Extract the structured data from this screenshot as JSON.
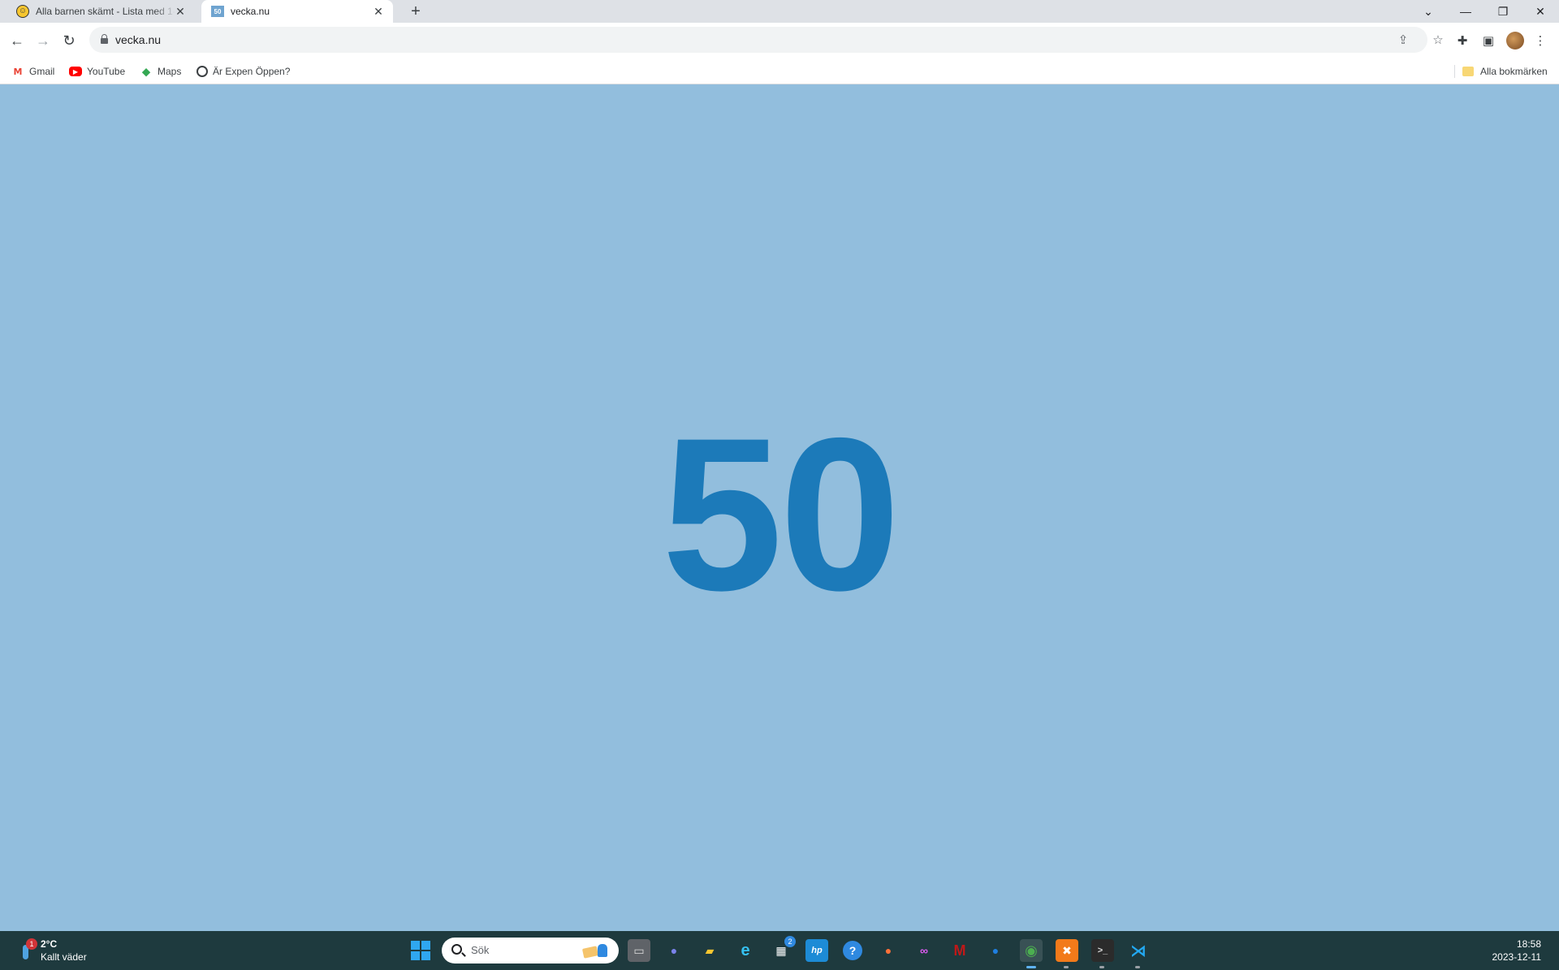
{
  "browser": {
    "tabs": [
      {
        "title": "Alla barnen skämt - Lista med 1-",
        "favicon": "laughing-emoji-icon",
        "active": false
      },
      {
        "title": "vecka.nu",
        "favicon": "50",
        "active": true
      }
    ],
    "new_tab": "+",
    "window_controls": {
      "tab_search": "⌄",
      "minimize": "—",
      "restore": "❐",
      "close": "✕"
    },
    "address": {
      "url": "vecka.nu"
    },
    "nav": {
      "back": "←",
      "forward": "→",
      "reload": "↻"
    },
    "toolbar_icons": {
      "share": "⇪",
      "star": "☆",
      "extensions": "✚",
      "side_panel": "▣",
      "menu": "⋮"
    },
    "bookmarks": [
      {
        "label": "Gmail",
        "icon": "gmail-icon",
        "glyph": "M"
      },
      {
        "label": "YouTube",
        "icon": "youtube-icon",
        "glyph": "▶"
      },
      {
        "label": "Maps",
        "icon": "maps-pin-icon",
        "glyph": "⬥"
      },
      {
        "label": "Är Expen Öppen?",
        "icon": "globe-icon",
        "glyph": ""
      }
    ],
    "all_bookmarks": "Alla bokmärken"
  },
  "page": {
    "week_number": "50",
    "background": "#92bedd",
    "text_color": "#1c7ab9"
  },
  "taskbar": {
    "weather": {
      "temp": "2°C",
      "condition": "Kallt väder",
      "badge": "1"
    },
    "search_placeholder": "Sök",
    "apps": [
      {
        "name": "file-explorer-icon",
        "glyph": "▭"
      },
      {
        "name": "teams-icon",
        "glyph": "●"
      },
      {
        "name": "folder-icon",
        "glyph": "▰"
      },
      {
        "name": "edge-icon",
        "glyph": "e"
      },
      {
        "name": "store-icon",
        "glyph": "▦",
        "badge": "2"
      },
      {
        "name": "hp-app-icon",
        "glyph": "hp"
      },
      {
        "name": "help-icon",
        "glyph": "?"
      },
      {
        "name": "firefox-icon",
        "glyph": "●"
      },
      {
        "name": "mask-app-icon",
        "glyph": "∞"
      },
      {
        "name": "mcafee-icon",
        "glyph": "M"
      },
      {
        "name": "thunderbird-icon",
        "glyph": "●"
      },
      {
        "name": "chrome-icon",
        "glyph": "◉"
      },
      {
        "name": "xampp-icon",
        "glyph": "✖"
      },
      {
        "name": "terminal-icon",
        "glyph": ">_"
      },
      {
        "name": "vscode-icon",
        "glyph": "⋊"
      }
    ],
    "clock": {
      "time": "18:58",
      "date": "2023-12-11"
    }
  }
}
